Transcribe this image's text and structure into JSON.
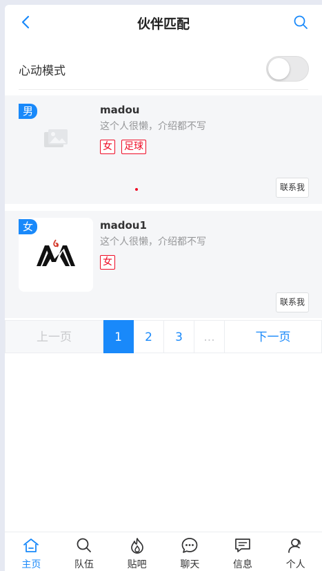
{
  "navbar": {
    "title": "伙伴匹配"
  },
  "mode": {
    "label": "心动模式",
    "enabled": false
  },
  "users": [
    {
      "gender": "男",
      "username": "madou",
      "intro": "这个人很懒，介绍都不写",
      "tags": [
        "女",
        "足球"
      ],
      "contact_label": "联系我"
    },
    {
      "gender": "女",
      "username": "madou1",
      "intro": "这个人很懒，介绍都不写",
      "tags": [
        "女"
      ],
      "contact_label": "联系我"
    }
  ],
  "pagination": {
    "prev_label": "上一页",
    "pages": [
      "1",
      "2",
      "3"
    ],
    "ellipsis": "...",
    "next_label": "下一页",
    "current": 1
  },
  "tabbar": {
    "items": [
      {
        "label": "主页",
        "icon": "home-icon",
        "active": true
      },
      {
        "label": "队伍",
        "icon": "search-icon",
        "active": false
      },
      {
        "label": "贴吧",
        "icon": "fire-icon",
        "active": false
      },
      {
        "label": "聊天",
        "icon": "chat-icon",
        "active": false
      },
      {
        "label": "信息",
        "icon": "message-icon",
        "active": false
      },
      {
        "label": "个人",
        "icon": "user-icon",
        "active": false
      }
    ]
  },
  "colors": {
    "primary": "#1989fa",
    "tag": "#ee0a24",
    "card_bg": "#f5f6f8"
  }
}
